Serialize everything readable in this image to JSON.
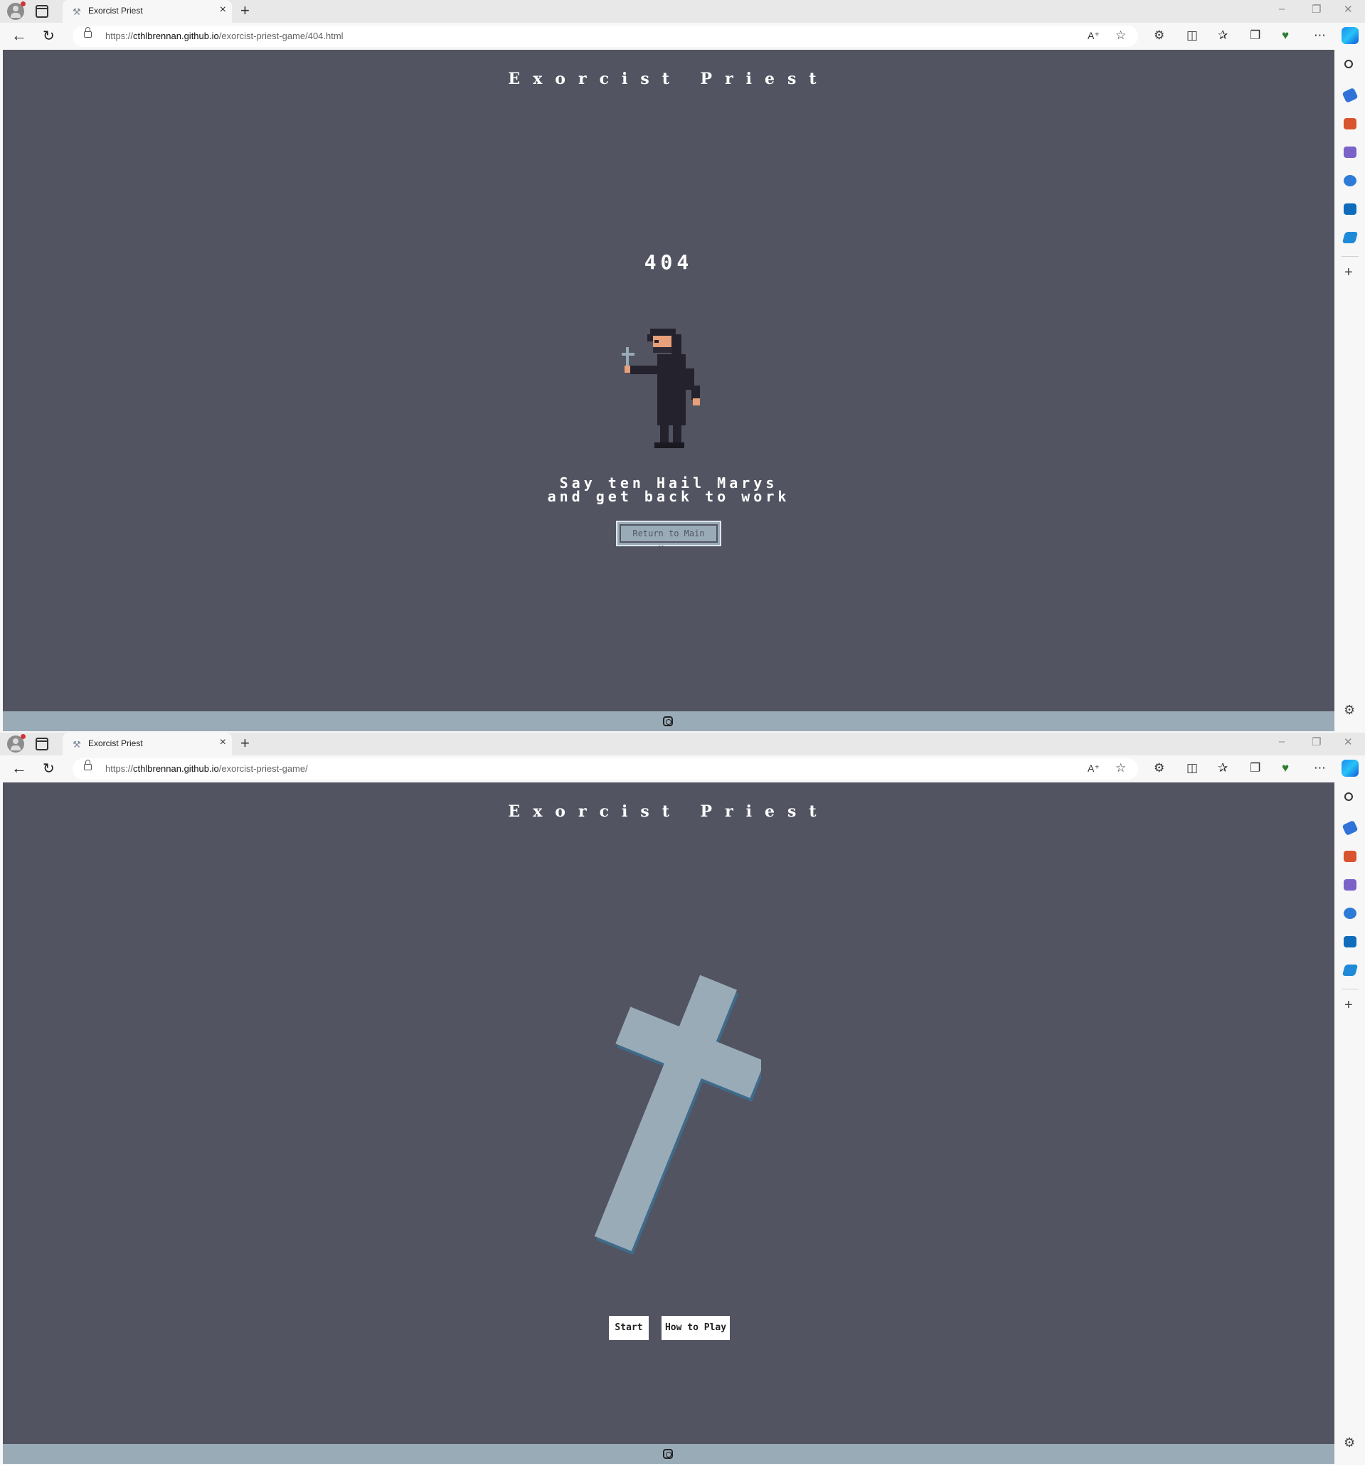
{
  "windows": [
    {
      "tab": {
        "title": "Exorcist Priest"
      },
      "address": {
        "scheme": "https://",
        "host": "cthlbrennan.github.io",
        "path": "/exorcist-priest-game/404.html"
      },
      "page": {
        "title": "Exorcist Priest",
        "error_code": "404",
        "message_line1": "Say ten Hail Marys",
        "message_line2": "and get back to work",
        "return_button": "Return to Main Menu"
      }
    },
    {
      "tab": {
        "title": "Exorcist Priest"
      },
      "address": {
        "scheme": "https://",
        "host": "cthlbrennan.github.io",
        "path": "/exorcist-priest-game/"
      },
      "page": {
        "title": "Exorcist Priest",
        "start_button": "Start",
        "howto_button": "How to Play"
      }
    }
  ],
  "colors": {
    "page_bg": "#525461",
    "footer_bg": "#9aabb8",
    "cross_face": "#9aabb8",
    "cross_side": "#3f6b8a"
  },
  "icons": {
    "footer": "instagram-icon",
    "toolbar": [
      "back-icon",
      "refresh-icon",
      "read-aloud-icon",
      "favorite-icon",
      "extensions-icon",
      "split-screen-icon",
      "favorites-icon",
      "collections-icon",
      "browser-essentials-icon",
      "more-icon",
      "copilot-icon"
    ]
  }
}
